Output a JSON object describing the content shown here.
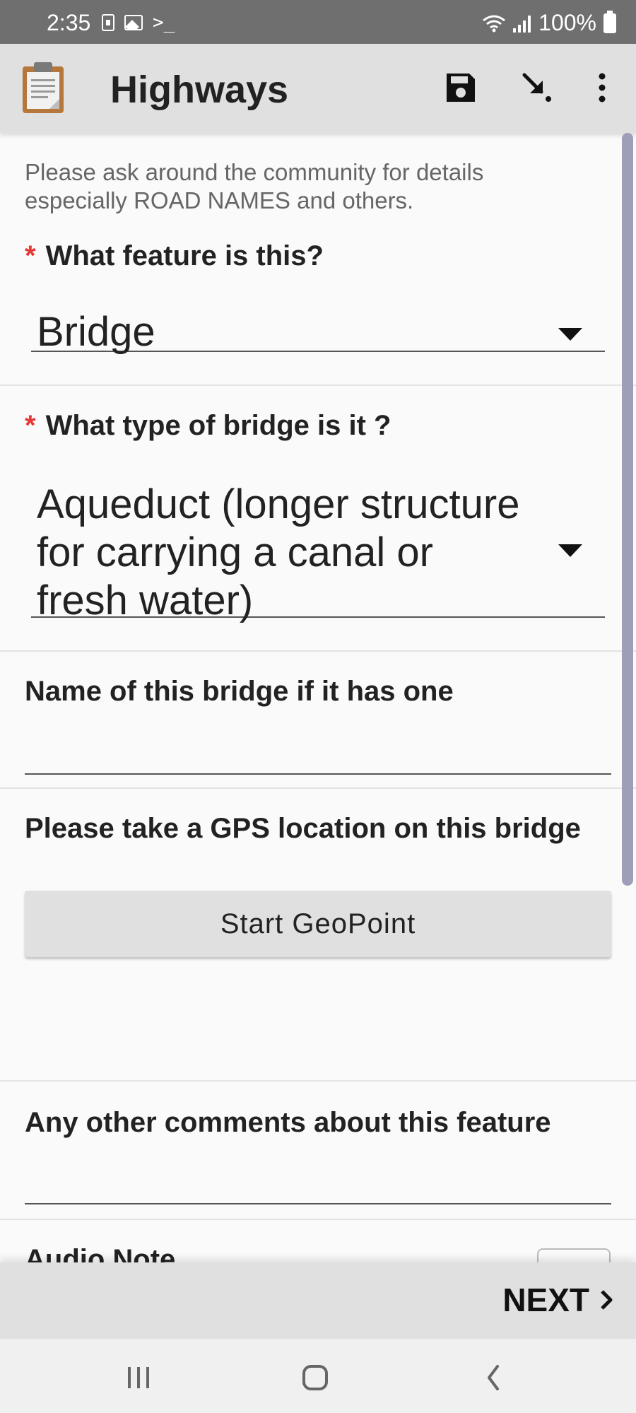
{
  "status_bar": {
    "time": "2:35",
    "battery": "100%"
  },
  "app_bar": {
    "title": "Highways",
    "icons": [
      "clipboard-icon",
      "save-icon",
      "go-to-icon",
      "more-vert-icon"
    ]
  },
  "form": {
    "hint": "Please ask around the community for details especially ROAD NAMES and others.",
    "q_feature": {
      "required_mark": "*",
      "label": "What feature is this?",
      "value": "Bridge"
    },
    "q_bridge_type": {
      "required_mark": "*",
      "label": "What type of bridge is it ?",
      "value": "Aqueduct (longer structure for carrying a canal or fresh water)"
    },
    "q_bridge_name": {
      "label": "Name of this bridge if it has one",
      "value": ""
    },
    "q_gps": {
      "label": "Please take a GPS location on this bridge",
      "button": "Start GeoPoint"
    },
    "q_comments": {
      "label": "Any other comments about this feature",
      "value": ""
    },
    "q_audio": {
      "label": "Audio Note"
    }
  },
  "bottom_bar": {
    "next_label": "NEXT"
  },
  "nav_bar": {
    "icons": [
      "recents-icon",
      "home-icon",
      "back-icon"
    ]
  },
  "colors": {
    "app_bar": "#e0e0e0",
    "status_bar": "#6f6f6f",
    "required": "#e53935",
    "scrollbar": "#9e9eb8"
  }
}
